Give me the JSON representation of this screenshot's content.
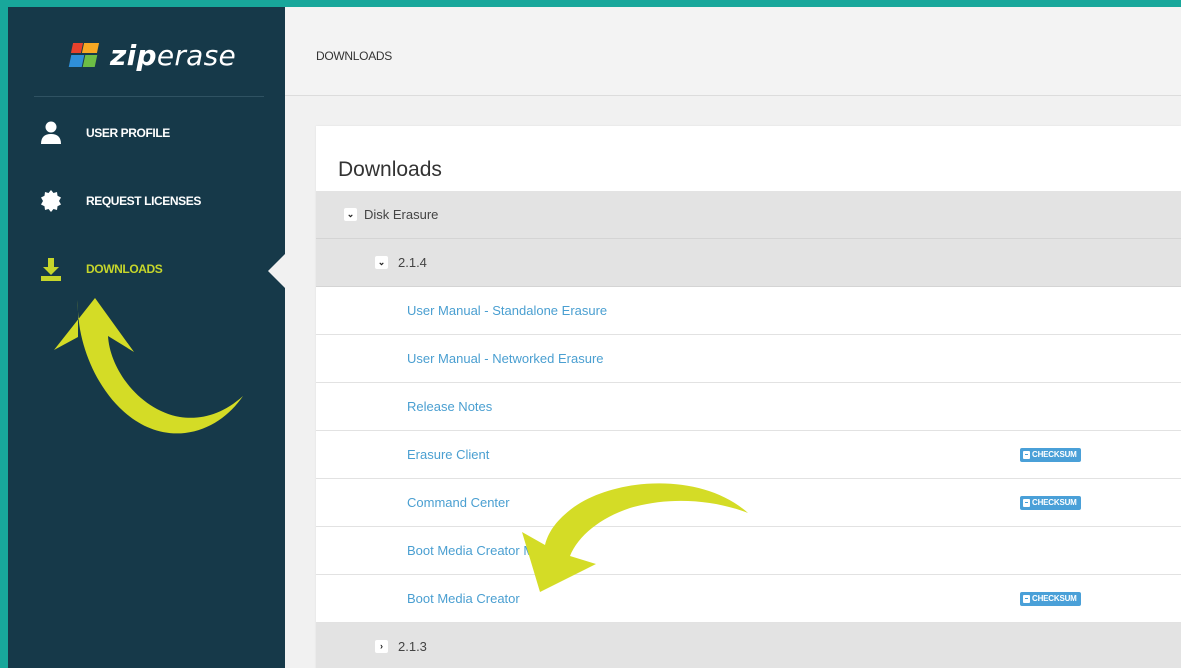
{
  "brand": {
    "logo_bold": "zip",
    "logo_regular": "erase"
  },
  "sidebar": {
    "items": [
      {
        "label": "USER PROFILE",
        "icon": "user-icon",
        "active": false
      },
      {
        "label": "REQUEST LICENSES",
        "icon": "badge-icon",
        "active": false
      },
      {
        "label": "DOWNLOADS",
        "icon": "download-icon",
        "active": true
      }
    ]
  },
  "header": {
    "title": "DOWNLOADS"
  },
  "panel": {
    "title": "Downloads",
    "category": {
      "label": "Disk Erasure",
      "expanded": true
    },
    "versions": [
      {
        "label": "2.1.4",
        "expanded": true
      },
      {
        "label": "2.1.3",
        "expanded": false
      }
    ],
    "files": [
      {
        "label": "User Manual - Standalone Erasure",
        "checksum": false
      },
      {
        "label": "User Manual - Networked Erasure",
        "checksum": false
      },
      {
        "label": "Release Notes",
        "checksum": false
      },
      {
        "label": "Erasure Client",
        "checksum": true
      },
      {
        "label": "Command Center",
        "checksum": true
      },
      {
        "label": "Boot Media Creator M",
        "checksum": false
      },
      {
        "label": "Boot Media Creator",
        "checksum": true
      }
    ],
    "checksum_label": "CHECKSUM"
  },
  "colors": {
    "frame": "#18a79b",
    "sidebar": "#163949",
    "active_nav": "#c6d62b",
    "link": "#4a9fd1",
    "annotation_arrow": "#d4dc26"
  }
}
